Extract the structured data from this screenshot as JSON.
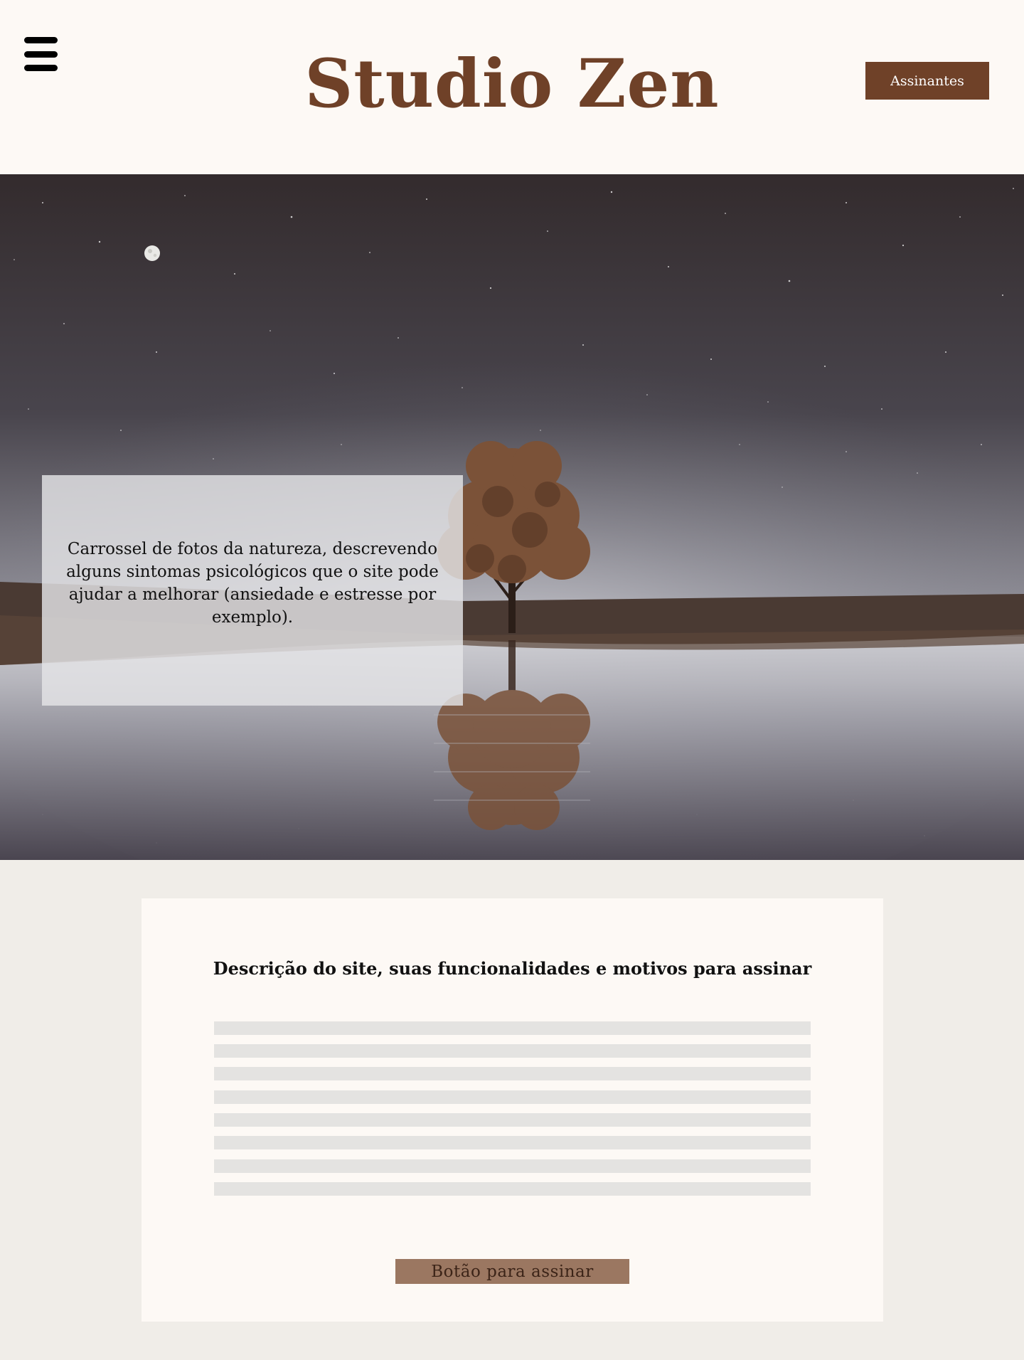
{
  "header": {
    "menu_icon": "hamburger-menu-icon",
    "title": "Studio Zen",
    "subscribers_button": "Assinantes"
  },
  "hero": {
    "caption": "Carrossel de fotos da natureza, descrevendo alguns sintomas psicológicos que o site pode ajudar a melhorar (ansiedade e estresse por exemplo)."
  },
  "description": {
    "title": "Descrição do site, suas funcionalidades e motivos para assinar",
    "subscribe_button": "Botão para assinar"
  },
  "colors": {
    "brand_brown": "#6f4128",
    "button_light_brown": "#9b7761",
    "page_background": "#f0ede8",
    "card_background": "#fdf9f5",
    "placeholder_gray": "#e4e3e1"
  }
}
